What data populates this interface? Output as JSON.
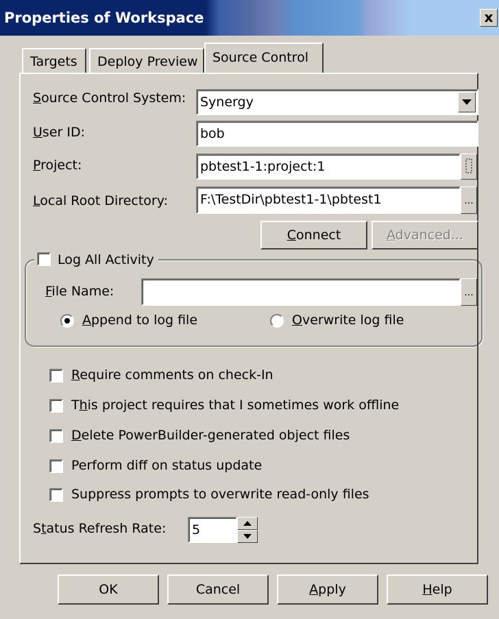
{
  "window": {
    "title": "Properties of Workspace",
    "close_glyph": "x"
  },
  "tabs": [
    {
      "label": "Targets",
      "active": false
    },
    {
      "label": "Deploy Preview",
      "active": false
    },
    {
      "label": "Source Control",
      "active": true
    }
  ],
  "form": {
    "scs_label_pre": "",
    "scs_label_u": "S",
    "scs_label_post": "ource Control System:",
    "scs_value": "Synergy",
    "userid_label_u": "U",
    "userid_label_post": "ser ID:",
    "userid_value": "bob",
    "project_label_u": "P",
    "project_label_post": "roject:",
    "project_value": "pbtest1-1:project:1",
    "localroot_label_u": "L",
    "localroot_label_post": "ocal Root Directory:",
    "localroot_value": "F:\\TestDir\\pbtest1-1\\pbtest1",
    "browse_glyph": "...",
    "connect_pre": "",
    "connect_u": "C",
    "connect_post": "onnect",
    "advanced_pre": "",
    "advanced_u": "A",
    "advanced_post": "dvanced..."
  },
  "log": {
    "log_all_pre": "Lo",
    "log_all_u": "g",
    "log_all_post": " All Activity",
    "log_all_checked": false,
    "filename_label_u": "F",
    "filename_label_post": "ile Name:",
    "filename_value": "",
    "append_u": "A",
    "append_post": "ppend to log file",
    "append_selected": true,
    "overwrite_u": "O",
    "overwrite_post": "verwrite log file",
    "overwrite_selected": false
  },
  "options": [
    {
      "pre": "",
      "u": "R",
      "post": "equire comments on check-In",
      "checked": false
    },
    {
      "pre": "T",
      "u": "h",
      "post": "is project requires that I sometimes work offline",
      "checked": false
    },
    {
      "pre": "",
      "u": "D",
      "post": "elete PowerBuilder-generated object files",
      "checked": false
    },
    {
      "pre": "Perform diff on status update",
      "u": "",
      "post": "",
      "checked": false
    },
    {
      "pre": "Suppress prompts to overwrite read-only files",
      "u": "",
      "post": "",
      "checked": false
    }
  ],
  "refresh": {
    "label_pre": "S",
    "label_u": "t",
    "label_post": "atus Refresh Rate:",
    "value": "5"
  },
  "buttons": {
    "ok": "OK",
    "cancel": "Cancel",
    "apply_u": "A",
    "apply_post": "pply",
    "help_u": "H",
    "help_post": "elp"
  }
}
